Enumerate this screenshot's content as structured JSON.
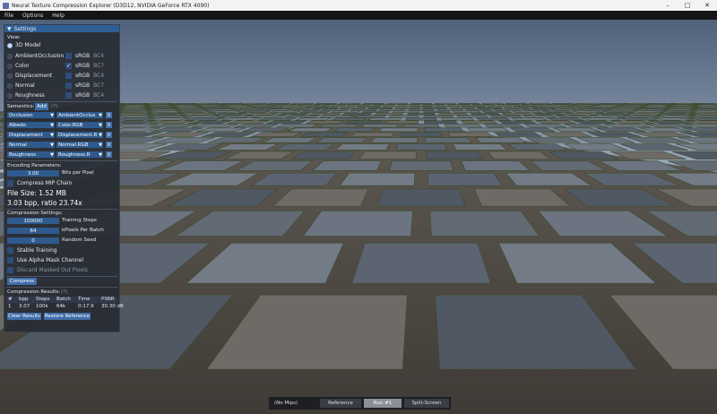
{
  "window": {
    "title": "Neural Texture Compression Explorer (D3D12, NVIDIA GeForce RTX 4090)"
  },
  "menu": [
    "File",
    "Options",
    "Help"
  ],
  "panel": {
    "header": "Settings",
    "view_label": "View:",
    "views": [
      {
        "label": "3D Model",
        "selected": true,
        "show_checkbox": false
      },
      {
        "label": "AmbientOcclusion",
        "selected": false,
        "srgb_checked": false,
        "format": "BC4"
      },
      {
        "label": "Color",
        "selected": false,
        "srgb_checked": true,
        "format": "BC7"
      },
      {
        "label": "Displacement",
        "selected": false,
        "srgb_checked": false,
        "format": "BC4"
      },
      {
        "label": "Normal",
        "selected": false,
        "srgb_checked": false,
        "format": "BC7"
      },
      {
        "label": "Roughness",
        "selected": false,
        "srgb_checked": false,
        "format": "BC4"
      }
    ],
    "srgb_label": "sRGB",
    "semantics_label": "Semantics:",
    "add_label": "Add",
    "help": "(?)",
    "semantics": [
      {
        "type": "Occlusion",
        "channel": "AmbientOcclus"
      },
      {
        "type": "Albedo",
        "channel": "Color.RGB"
      },
      {
        "type": "Displacement",
        "channel": "Displacement.R"
      },
      {
        "type": "Normal",
        "channel": "Normal.RGB"
      },
      {
        "type": "Roughness",
        "channel": "Roughness.R"
      }
    ],
    "remove_label": "X",
    "encoding_label": "Encoding Parameters:",
    "bits_per_pixel_value": "3.00",
    "bits_per_pixel_label": "Bits per Pixel",
    "compress_mip_label": "Compress MIP Chain",
    "file_size": "File Size: 1.52 MB",
    "ratio": "3.03 bpp, ratio 23.74x",
    "compression_settings_label": "Compression Settings:",
    "training_steps_value": "100000",
    "training_steps_label": "Training Steps",
    "kpixels_value": "64",
    "kpixels_label": "kPixels Per Batch",
    "seed_value": "0",
    "seed_label": "Random Seed",
    "stable_training_label": "Stable Training",
    "alpha_mask_label": "Use Alpha Mask Channel",
    "discard_masked_label": "Discard Masked Out Pixels",
    "compress_button": "Compress",
    "results_label": "Compression Results:",
    "results_headers": [
      "#",
      "bpp",
      "Steps",
      "Batch",
      "Time",
      "PSNR"
    ],
    "results_rows": [
      [
        "1",
        "3.07",
        "100k",
        "64k",
        "0:17.9",
        "30.30 dB"
      ]
    ],
    "clear_results": "Clear Results",
    "restore_reference": "Restore Reference"
  },
  "bottom": {
    "mips_label": "(No Mips)",
    "reference": "Reference",
    "run": "Run #1",
    "split": "Split-Screen"
  },
  "colors": {
    "accent": "#3f6ea8",
    "header": "#2f5f97",
    "panel_bg": "#282c34"
  }
}
